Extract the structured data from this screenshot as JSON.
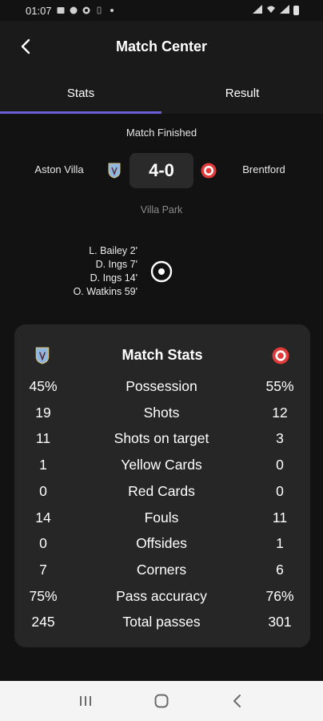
{
  "status_bar": {
    "time": "01:07",
    "icons_left": [
      "photo-icon",
      "chat-icon",
      "settings-icon",
      "vibrate-icon",
      "dot-icon"
    ],
    "icons_right": [
      "signal-icon",
      "wifi-icon",
      "signal-icon",
      "battery-icon"
    ]
  },
  "header": {
    "title": "Match Center",
    "back_icon": "chevron-left-icon"
  },
  "tabs": [
    {
      "label": "Stats",
      "active": true
    },
    {
      "label": "Result",
      "active": false
    }
  ],
  "match": {
    "status": "Match Finished",
    "home_team": "Aston Villa",
    "away_team": "Brentford",
    "score": "4-0",
    "venue": "Villa Park",
    "scorers": [
      "L. Bailey 2'",
      "D. Ings 7'",
      "D. Ings 14'",
      "O. Watkins 59'"
    ],
    "goal_icon": "football-icon"
  },
  "stats": {
    "title": "Match Stats",
    "rows": [
      {
        "home": "45%",
        "label": "Possession",
        "away": "55%"
      },
      {
        "home": "19",
        "label": "Shots",
        "away": "12"
      },
      {
        "home": "11",
        "label": "Shots on target",
        "away": "3"
      },
      {
        "home": "1",
        "label": "Yellow Cards",
        "away": "0"
      },
      {
        "home": "0",
        "label": "Red Cards",
        "away": "0"
      },
      {
        "home": "14",
        "label": "Fouls",
        "away": "11"
      },
      {
        "home": "0",
        "label": "Offsides",
        "away": "1"
      },
      {
        "home": "7",
        "label": "Corners",
        "away": "6"
      },
      {
        "home": "75%",
        "label": "Pass accuracy",
        "away": "76%"
      },
      {
        "home": "245",
        "label": "Total passes",
        "away": "301"
      }
    ]
  },
  "nav_bar": {
    "buttons": [
      "recents-icon",
      "home-icon",
      "back-icon"
    ]
  },
  "colors": {
    "background": "#121212",
    "header": "#1a1a1a",
    "card": "#262626",
    "accent": "#6a5fd6",
    "home_crest": "#8fb8e0",
    "away_crest": "#e03a3a"
  }
}
